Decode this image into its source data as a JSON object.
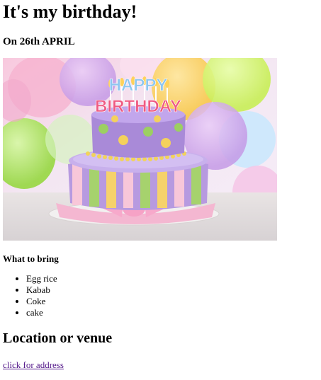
{
  "page": {
    "title": "It's my birthday!",
    "subtitle": "On 26th APRIL",
    "image": {
      "name": "birthday-cake-image",
      "cake_text_line1": "HAPPY",
      "cake_text_line2": "BIRTHDAY"
    },
    "bring": {
      "heading": "What to bring",
      "items": [
        "Egg rice",
        "Kabab",
        "Coke",
        "cake"
      ]
    },
    "location": {
      "heading": "Location or venue",
      "link_text": "click for address"
    }
  }
}
